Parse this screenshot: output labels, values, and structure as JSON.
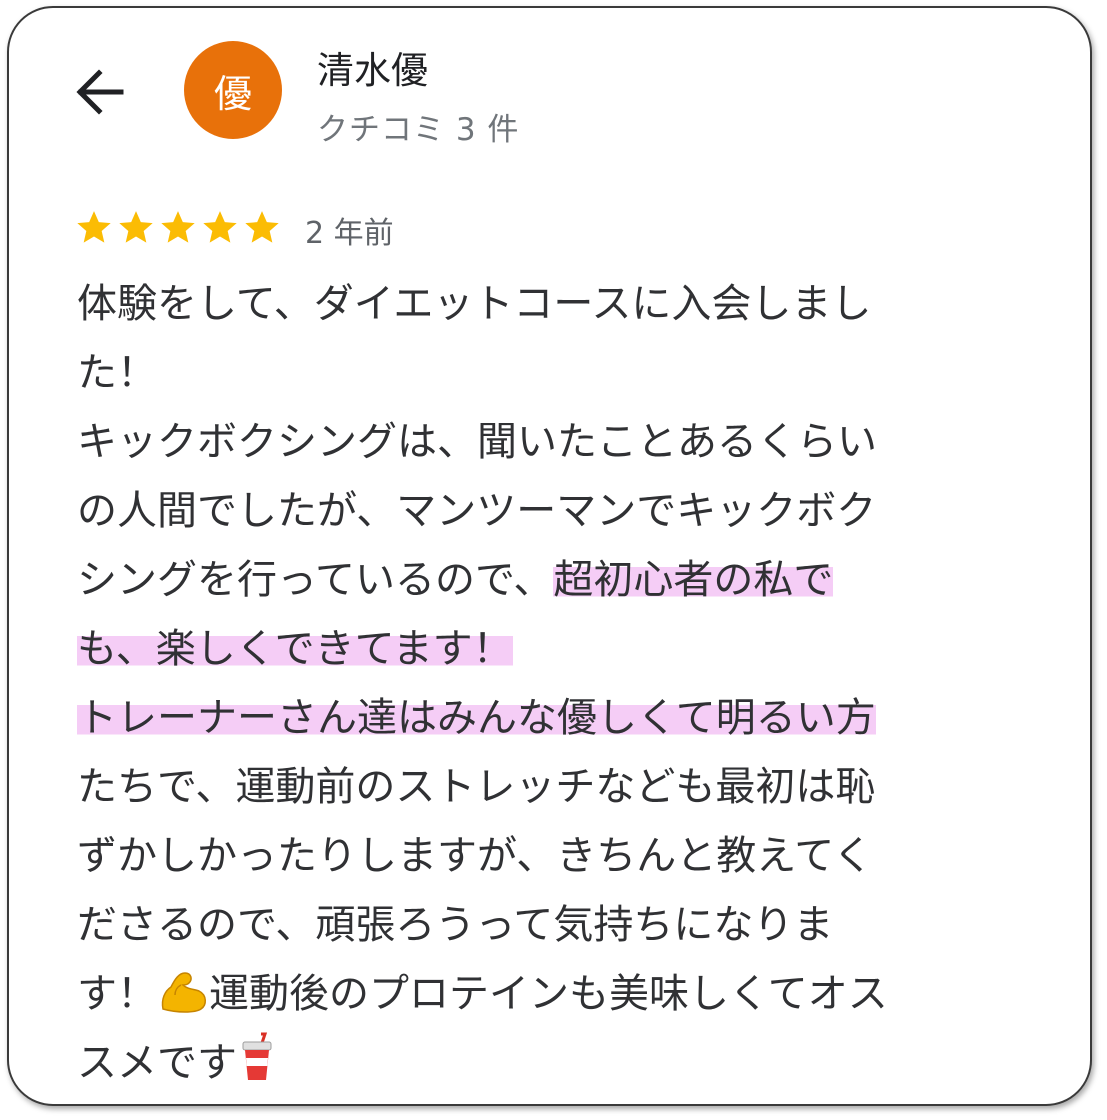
{
  "reviewer": {
    "avatar_initial": "優",
    "avatar_color": "#e8710a",
    "name": "清水優",
    "review_count": "クチコミ 3 件"
  },
  "rating": {
    "stars": 5,
    "max": 5,
    "star_color": "#fbbc04"
  },
  "time_ago": "2 年前",
  "review": {
    "highlight_color": "#f5cdf6",
    "lines": [
      "体験をして、ダイエットコースに入会しまし",
      "た！",
      "キックボクシングは、聞いたことあるくらい",
      "の人間でしたが、マンツーマンでキックボク",
      "シングを行っているので、",
      "超初心者の私で",
      "も、楽しくできてます！",
      "トレーナーさん達はみんな優しくて明るい方",
      "たちで、運動前のストレッチなども最初は恥",
      "ずかしかったりしますが、きちんと教えてく",
      "ださるので、頑張ろうって気持ちになりま",
      "す！",
      "運動後のプロテインも美味しくてオス",
      "スメです"
    ],
    "emojis": [
      "flexed-biceps-emoji",
      "cup-with-straw-emoji"
    ]
  },
  "icons": {
    "back": "arrow-back-icon",
    "star": "star-icon"
  }
}
